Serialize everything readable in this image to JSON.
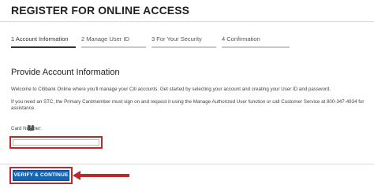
{
  "header": {
    "title": "REGISTER FOR ONLINE ACCESS"
  },
  "steps": [
    {
      "label": "1 Account Information",
      "active": true
    },
    {
      "label": "2 Manage User ID",
      "active": false
    },
    {
      "label": "3 For Your Security",
      "active": false
    },
    {
      "label": "4 Confirmation",
      "active": false
    }
  ],
  "main": {
    "section_title": "Provide Account Information",
    "intro": "Welcome to Citibank Online where you'll manage your Citi accounts. Get started by selecting your account and creating your User ID and password.",
    "stc_note": "If you need an STC, the Primary Cardmember must sign on and request it using the Manage Authorized User function or call Customer Service at 800-347-4934 for assistance.",
    "card_number_label": "Card Number:",
    "help_icon_text": "?",
    "card_number_value": "",
    "verify_button_label": "VERIFY & CONTINUE"
  },
  "colors": {
    "highlight": "#c0272d",
    "button": "#1565b5"
  }
}
